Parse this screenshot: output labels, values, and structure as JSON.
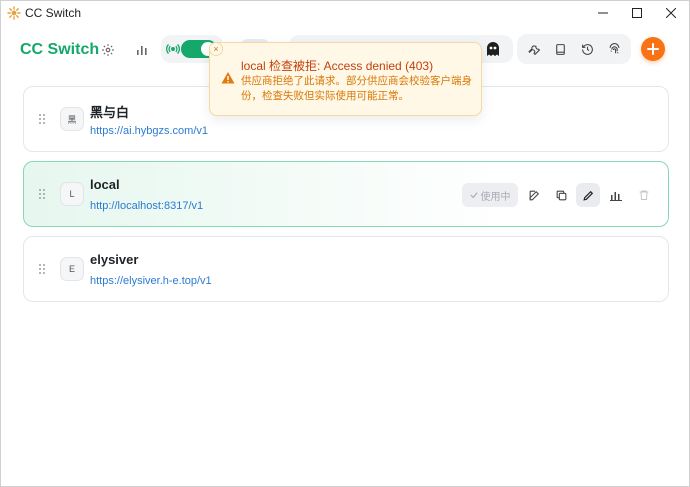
{
  "window": {
    "title": "CC Switch"
  },
  "header": {
    "brand": "CC Switch"
  },
  "colors": {
    "brand": "#14a86a",
    "accent": "#f97316",
    "link": "#2b7bd1",
    "warning": "#d97706"
  },
  "toast": {
    "title": "local 检查被拒: Access denied (403)",
    "message": "供应商拒绝了此请求。部分供应商会校验客户端身份，检查失败但实际使用可能正常。",
    "close": "×"
  },
  "providers": [
    {
      "avatar": "黑",
      "name": "黑与白",
      "url": "https://ai.hybgzs.com/v1",
      "active": false
    },
    {
      "avatar": "L",
      "name": "local",
      "url": "http://localhost:8317/v1",
      "active": true,
      "status_label": "使用中"
    },
    {
      "avatar": "E",
      "name": "elysiver",
      "url": "https://elysiver.h-e.top/v1",
      "active": false
    }
  ]
}
